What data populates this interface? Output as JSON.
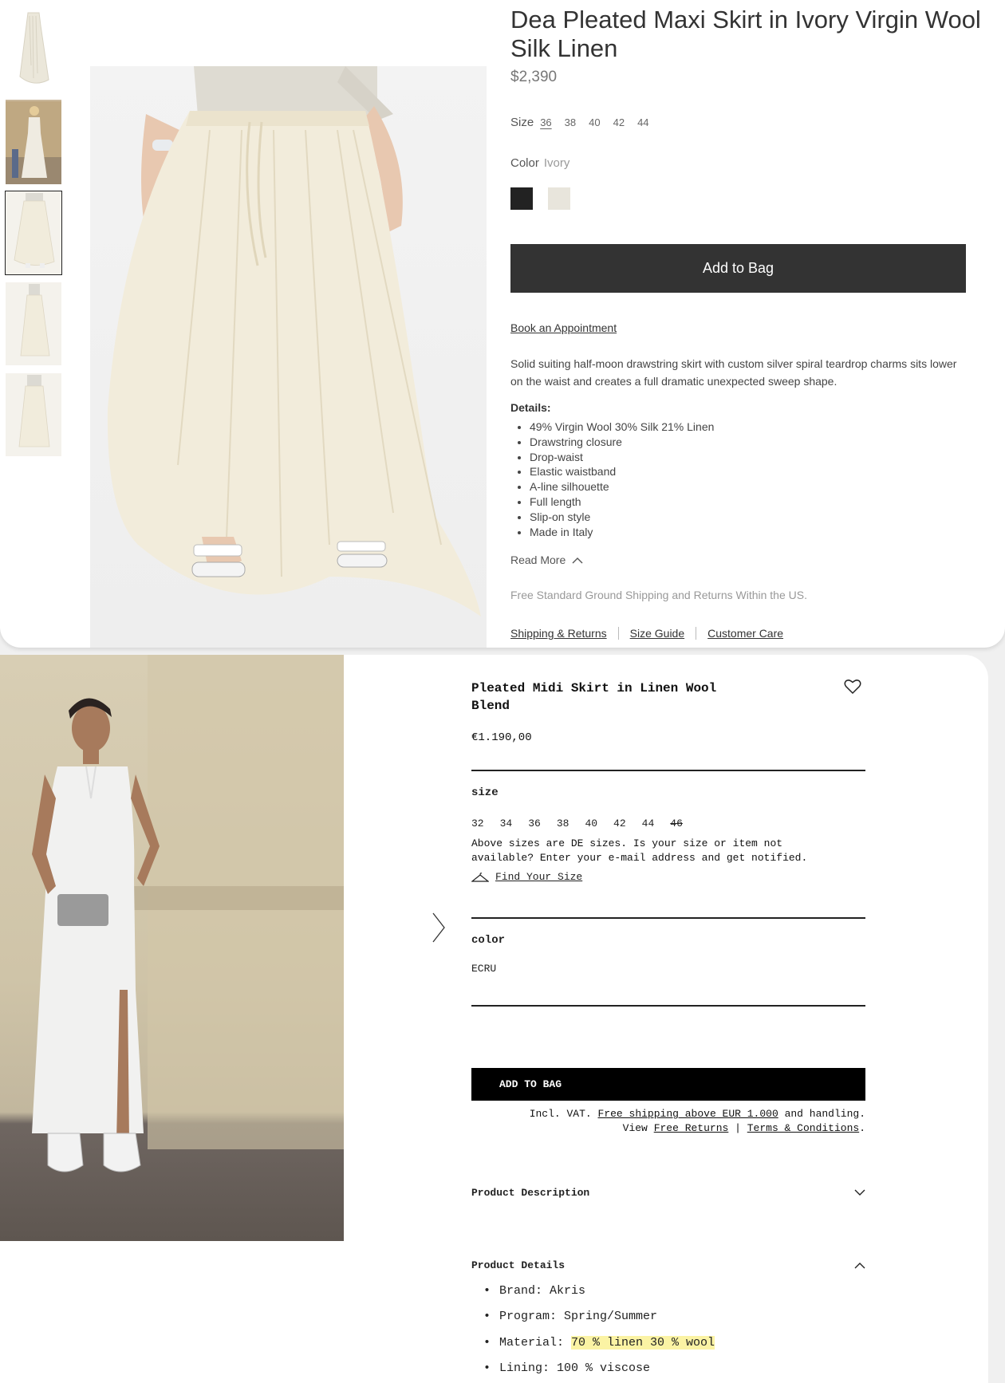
{
  "top": {
    "title": "Dea Pleated Maxi Skirt in Ivory Virgin Wool Silk Linen",
    "price": "$2,390",
    "size_label": "Size",
    "sizes": [
      "36",
      "38",
      "40",
      "42",
      "44"
    ],
    "selected_size": "36",
    "color_label": "Color",
    "color_value": "Ivory",
    "swatches": [
      {
        "name": "Black",
        "hex": "#222222"
      },
      {
        "name": "Ivory",
        "hex": "#e8e5dc"
      }
    ],
    "add_to_bag": "Add to Bag",
    "book_appointment": "Book an Appointment",
    "description": "Solid suiting half-moon drawstring skirt with custom silver spiral teardrop charms sits lower on the waist and creates a full dramatic unexpected sweep shape.",
    "details_heading": "Details:",
    "details": [
      "49% Virgin Wool 30% Silk 21% Linen",
      "Drawstring closure",
      "Drop-waist",
      "Elastic waistband",
      "A-line silhouette",
      "Full length",
      "Slip-on style",
      "Made in Italy"
    ],
    "read_more": "Read More",
    "shipping_note": "Free Standard Ground Shipping and Returns Within the US.",
    "links": [
      "Shipping & Returns",
      "Size Guide",
      "Customer Care"
    ]
  },
  "bottom": {
    "title": "Pleated Midi Skirt in Linen Wool Blend",
    "price": "€1.190,00",
    "size_heading": "size",
    "sizes": [
      "32",
      "34",
      "36",
      "38",
      "40",
      "42",
      "44",
      "46"
    ],
    "unavailable_size": "46",
    "size_note": "Above sizes are DE sizes. Is your size or item not available? Enter your e-mail address and get notified.",
    "find_size": "Find Your Size",
    "color_heading": "color",
    "color_value": "ECRU",
    "add_to_bag": "ADD TO BAG",
    "vat_prefix": "Incl. VAT.",
    "free_shipping": "Free shipping above EUR 1.000",
    "vat_suffix": "and handling.",
    "view": "View",
    "free_returns": "Free Returns",
    "pipe": "|",
    "terms": "Terms & Conditions",
    "product_description": "Product Description",
    "product_details": "Product Details",
    "detail_items": [
      {
        "label": "Brand:",
        "value": "Akris"
      },
      {
        "label": "Program:",
        "value": "Spring/Summer"
      },
      {
        "label": "Material:",
        "value": "70 % linen 30 % wool"
      },
      {
        "label": "Lining:",
        "value": "100 % viscose"
      }
    ],
    "highlight_color": "#fbf3a4"
  }
}
